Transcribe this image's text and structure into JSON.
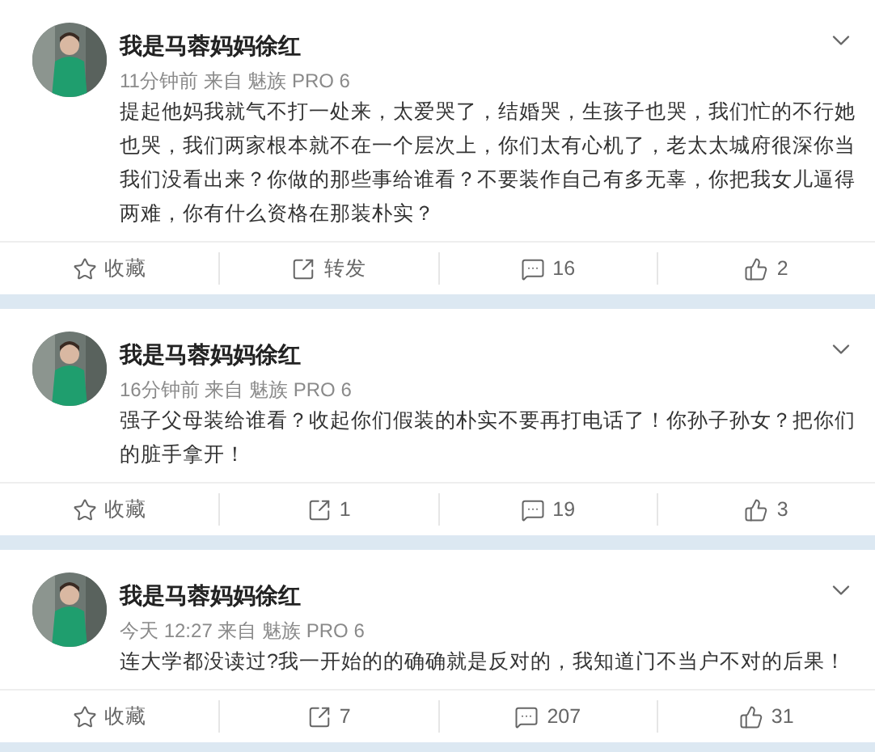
{
  "posts": [
    {
      "author": "我是马蓉妈妈徐红",
      "meta": "11分钟前 来自 魅族 PRO 6",
      "text": "提起他妈我就气不打一处来，太爱哭了，结婚哭，生孩子也哭，我们忙的不行她也哭，我们两家根本就不在一个层次上，你们太有心机了，老太太城府很深你当我们没看出来？你做的那些事给谁看？不要装作自己有多无辜，你把我女儿逼得两难，你有什么资格在那装朴实？",
      "actions": [
        {
          "kind": "favorite",
          "label": "收藏"
        },
        {
          "kind": "repost",
          "label": "转发"
        },
        {
          "kind": "comment",
          "label": "16"
        },
        {
          "kind": "like",
          "label": "2"
        }
      ]
    },
    {
      "author": "我是马蓉妈妈徐红",
      "meta": "16分钟前 来自 魅族 PRO 6",
      "text": "强子父母装给谁看？收起你们假装的朴实不要再打电话了！你孙子孙女？把你们的脏手拿开！",
      "actions": [
        {
          "kind": "favorite",
          "label": "收藏"
        },
        {
          "kind": "repost",
          "label": "1"
        },
        {
          "kind": "comment",
          "label": "19"
        },
        {
          "kind": "like",
          "label": "3"
        }
      ]
    },
    {
      "author": "我是马蓉妈妈徐红",
      "meta": "今天 12:27 来自 魅族 PRO 6",
      "text": "连大学都没读过?我一开始的的确确就是反对的，我知道门不当户不对的后果！",
      "actions": [
        {
          "kind": "favorite",
          "label": "收藏"
        },
        {
          "kind": "repost",
          "label": "7"
        },
        {
          "kind": "comment",
          "label": "207"
        },
        {
          "kind": "like",
          "label": "31"
        }
      ]
    }
  ]
}
